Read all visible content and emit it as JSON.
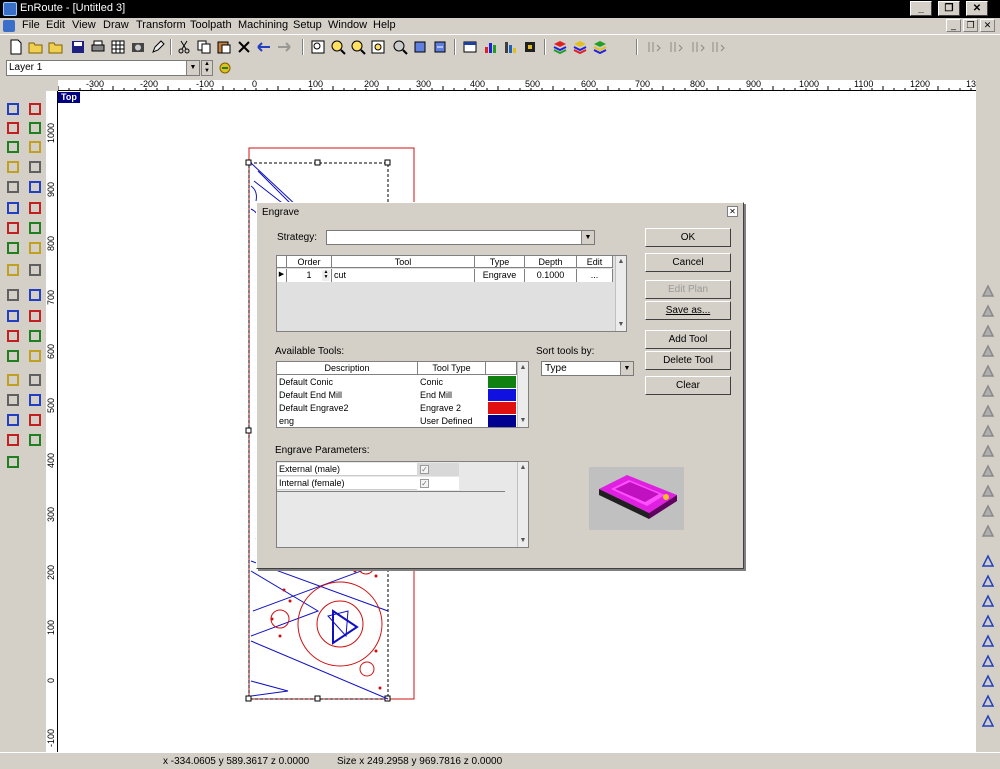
{
  "window": {
    "title": "EnRoute - [Untitled 3]"
  },
  "menu": [
    "File",
    "Edit",
    "View",
    "Draw",
    "Transform",
    "Toolpath",
    "Machining",
    "Setup",
    "Window",
    "Help"
  ],
  "layer": {
    "current": "Layer 1"
  },
  "rulers": {
    "horizontal": [
      "-300",
      "-200",
      "-100",
      "0",
      "100",
      "200",
      "300",
      "400",
      "500",
      "600",
      "700",
      "800",
      "900",
      "1000",
      "1100",
      "1200",
      "13"
    ],
    "vertical": [
      "1000",
      "900",
      "800",
      "700",
      "600",
      "500",
      "400",
      "300",
      "200",
      "100",
      "0",
      "-100"
    ]
  },
  "view": {
    "label": "Top"
  },
  "status": {
    "coords": "x -334.0605 y 589.3617 z 0.0000",
    "size": "Size x 249.2958 y 969.7816 z 0.0000"
  },
  "dialog": {
    "title": "Engrave",
    "strategy_label": "Strategy:",
    "strategy_value": "",
    "plan_table": {
      "headers": [
        "Order",
        "Tool",
        "Type",
        "Depth",
        "Edit"
      ],
      "rows": [
        {
          "order": "1",
          "tool": "cut",
          "type": "Engrave",
          "depth": "0.1000",
          "edit": "..."
        }
      ]
    },
    "buttons": {
      "ok": "OK",
      "cancel": "Cancel",
      "edit_plan": "Edit Plan",
      "save_as": "Save as...",
      "add_tool": "Add Tool",
      "delete_tool": "Delete Tool",
      "clear": "Clear"
    },
    "available_tools_label": "Available Tools:",
    "tools_table": {
      "headers": [
        "Description",
        "Tool Type"
      ],
      "rows": [
        {
          "description": "Default Conic",
          "type": "Conic",
          "color": "#108010"
        },
        {
          "description": "Default End Mill",
          "type": "End Mill",
          "color": "#1010e0"
        },
        {
          "description": "Default Engrave2",
          "type": "Engrave 2",
          "color": "#e01010"
        },
        {
          "description": "eng",
          "type": "User Defined",
          "color": "#000090"
        }
      ]
    },
    "sort_label": "Sort tools by:",
    "sort_value": "Type",
    "params_label": "Engrave Parameters:",
    "params": [
      {
        "name": "External (male)",
        "checked": true
      },
      {
        "name": "Internal (female)",
        "checked": true
      }
    ]
  },
  "colors": {
    "titlebar": "#000000",
    "chrome": "#d4d0c8",
    "accent_magenta": "#e020e0",
    "drawing_blue": "#1010c0",
    "drawing_red": "#d01010"
  }
}
